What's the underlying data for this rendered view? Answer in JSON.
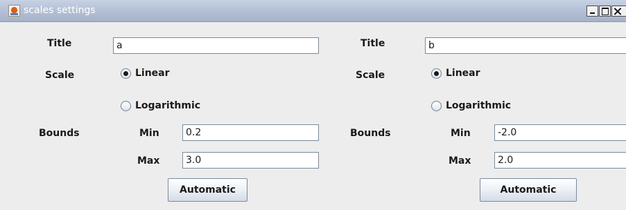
{
  "window": {
    "title": "scales settings",
    "icon": "java-cup-icon",
    "controls": [
      "minimize-icon",
      "maximize-icon",
      "close-icon"
    ]
  },
  "panels": [
    {
      "title_label": "Title",
      "title_value": "a",
      "scale_label": "Scale",
      "scale_options": [
        {
          "label": "Linear",
          "selected": true
        },
        {
          "label": "Logarithmic",
          "selected": false
        }
      ],
      "bounds_label": "Bounds",
      "min_label": "Min",
      "min_value": "0.2",
      "max_label": "Max",
      "max_value": "3.0",
      "auto_button": "Automatic"
    },
    {
      "title_label": "Title",
      "title_value": "b",
      "scale_label": "Scale",
      "scale_options": [
        {
          "label": "Linear",
          "selected": true
        },
        {
          "label": "Logarithmic",
          "selected": false
        }
      ],
      "bounds_label": "Bounds",
      "min_label": "Min",
      "min_value": "-2.0",
      "max_label": "Max",
      "max_value": "2.0",
      "auto_button": "Automatic"
    }
  ]
}
